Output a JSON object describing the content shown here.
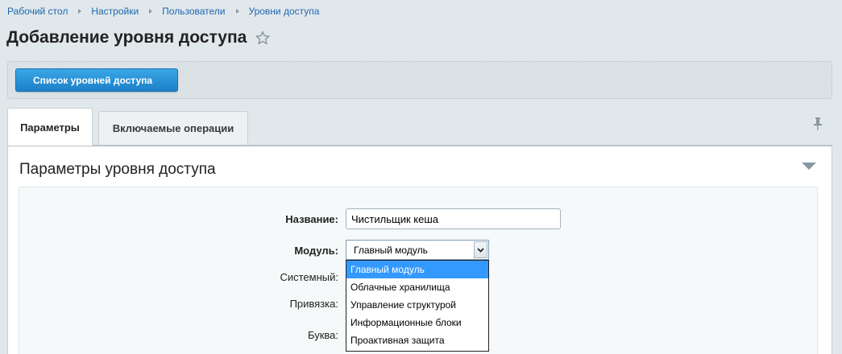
{
  "breadcrumb": [
    "Рабочий стол",
    "Настройки",
    "Пользователи",
    "Уровни доступа"
  ],
  "page": {
    "title": "Добавление уровня доступа"
  },
  "toolbar": {
    "list_button": "Список уровней доступа"
  },
  "tabs": [
    {
      "label": "Параметры",
      "active": true
    },
    {
      "label": "Включаемые операции",
      "active": false
    }
  ],
  "section": {
    "title": "Параметры уровня доступа"
  },
  "form": {
    "name_label": "Название:",
    "name_value": "Чистильщик кеша",
    "module_label": "Модуль:",
    "module_value": "Главный модуль",
    "system_label": "Системный:",
    "binding_label": "Привязка:",
    "letter_label": "Буква:",
    "module_options": [
      "Главный модуль",
      "Облачные хранилища",
      "Управление структурой",
      "Информационные блоки",
      "Проактивная защита"
    ]
  },
  "colors": {
    "accent": "#2067b0",
    "button": "#1c80c8",
    "selected_option": "#3399ff",
    "background": "#e1e8eb"
  },
  "icons": {
    "breadcrumb_separator": "triangle-right-icon",
    "favorite": "star-icon",
    "pin": "pin-icon",
    "collapse": "triangle-down-icon",
    "select_arrow": "chevron-down-icon"
  }
}
